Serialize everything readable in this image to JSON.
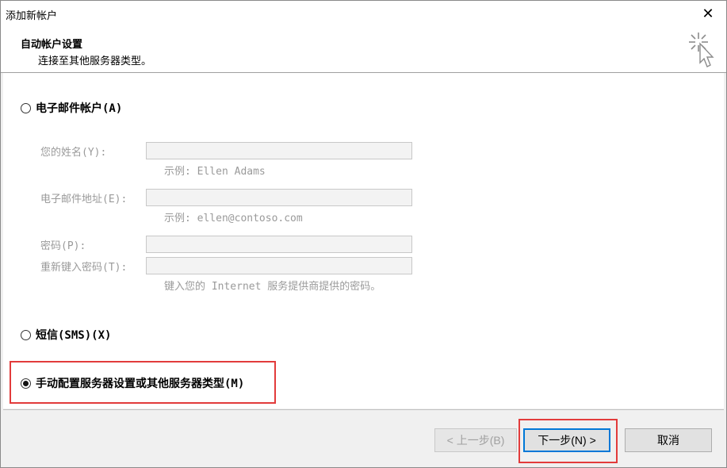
{
  "window": {
    "title": "添加新帐户",
    "close_glyph": "✕"
  },
  "header": {
    "title": "自动帐户设置",
    "subtitle": "连接至其他服务器类型。",
    "icon": "wizard-sparkle-cursor-icon"
  },
  "options": {
    "email": {
      "label": "电子邮件帐户(A)",
      "selected": false
    },
    "sms": {
      "label": "短信(SMS)(X)",
      "selected": false
    },
    "manual": {
      "label": "手动配置服务器设置或其他服务器类型(M)",
      "selected": true
    }
  },
  "email_form": {
    "name_label": "您的姓名(Y):",
    "name_value": "",
    "name_hint": "示例: Ellen Adams",
    "address_label": "电子邮件地址(E):",
    "address_value": "",
    "address_hint": "示例: ellen@contoso.com",
    "password_label": "密码(P):",
    "password_value": "",
    "retype_label": "重新键入密码(T):",
    "retype_value": "",
    "password_hint": "键入您的 Internet 服务提供商提供的密码。"
  },
  "buttons": {
    "back": "< 上一步(B)",
    "next": "下一步(N) >",
    "cancel": "取消"
  },
  "colors": {
    "highlight": "#e23b3b",
    "focus": "#0078d7",
    "disabled_text": "#9a9a9a"
  }
}
